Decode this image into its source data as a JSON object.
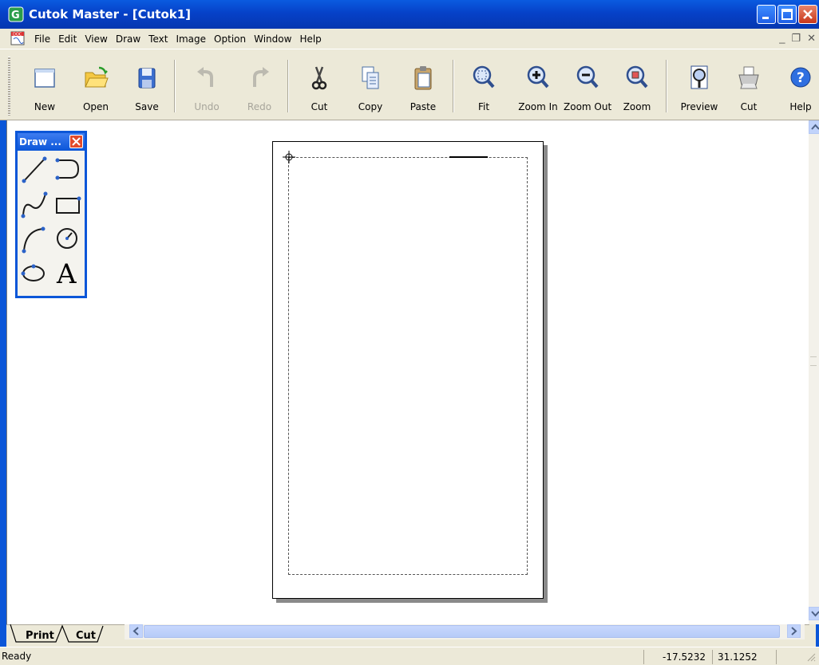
{
  "window": {
    "title": "Cutok Master - [Cutok1]"
  },
  "menu": [
    "File",
    "Edit",
    "View",
    "Draw",
    "Text",
    "Image",
    "Option",
    "Window",
    "Help"
  ],
  "toolbar": {
    "new": "New",
    "open": "Open",
    "save": "Save",
    "undo": "Undo",
    "redo": "Redo",
    "cut": "Cut",
    "copy": "Copy",
    "paste": "Paste",
    "fit": "Fit",
    "zoom_in": "Zoom In",
    "zoom_out": "Zoom Out",
    "zoom": "Zoom",
    "preview": "Preview",
    "cut2": "Cut",
    "help": "Help"
  },
  "draw_palette": {
    "title": "Draw ..."
  },
  "tabs": {
    "print": "Print",
    "cut": "Cut"
  },
  "status": {
    "text": "Ready",
    "x": "-17.5232",
    "y": "31.1252"
  }
}
